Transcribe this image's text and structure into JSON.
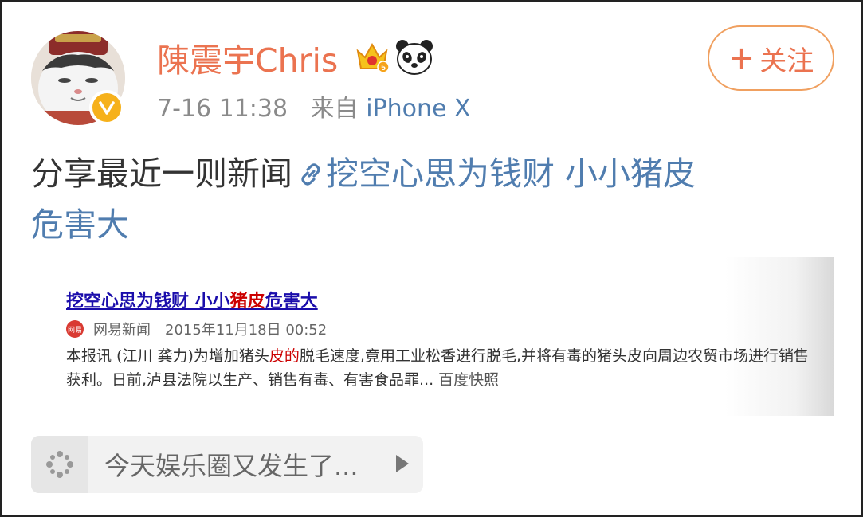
{
  "post": {
    "author": {
      "name": "陳震宇Chris",
      "badges": [
        "crown-badge-icon",
        "panda-icon"
      ],
      "verified_icon": "verified-v-icon"
    },
    "time": "7-16 11:38",
    "source_prefix": "来自",
    "source": "iPhone X",
    "follow_label": "关注",
    "content_text": "分享最近一则新闻",
    "link_text_line1": "挖空心思为钱财 小小猪皮",
    "link_text_line2": "危害大"
  },
  "card": {
    "title_part1": "挖空心思为钱财 小小",
    "title_part2": "猪皮",
    "title_part3": "危害大",
    "source_name": "网易新闻",
    "icon_text": "网易",
    "date": "2015年11月18日 00:52",
    "text_part1": "本报讯 (江川 龚力)为增加猪头",
    "text_hl": "皮的",
    "text_part2": "脱毛速度,竟用工业松香进行脱毛,并将有毒的猪头皮向周边农贸市场进行销售获利。日前,泸县法院以生产、销售有毒、有害食品罪...",
    "snapshot_label": "百度快照"
  },
  "topic": {
    "text": "今天娱乐圈又发生了...",
    "icon": "topic-sparkle-icon"
  },
  "colors": {
    "name": "#eb7350",
    "link": "#507daf",
    "verified": "#f6b11b",
    "follow_border": "#f0a060"
  }
}
